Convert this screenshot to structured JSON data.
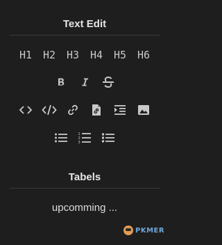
{
  "text_edit": {
    "title": "Text Edit",
    "headings": [
      "H1",
      "H2",
      "H3",
      "H4",
      "H5",
      "H6"
    ],
    "format_icons": [
      "bold-icon",
      "italic-icon",
      "strikethrough-icon"
    ],
    "insert_icons": [
      "inline-code-icon",
      "code-block-icon",
      "link-icon",
      "embed-file-icon",
      "indent-icon",
      "image-icon"
    ],
    "list_icons": [
      "bullet-list-icon",
      "numbered-list-icon",
      "task-list-icon"
    ]
  },
  "tables": {
    "title": "Tabels",
    "status": "upcomming ..."
  },
  "brand": {
    "name": "PKMER"
  },
  "colors": {
    "background": "#1e1e1e",
    "icon": "#c9c9c9",
    "divider": "#3a3a3a",
    "brand_text": "#6fa6d8",
    "brand_mark": "#e39a55"
  }
}
